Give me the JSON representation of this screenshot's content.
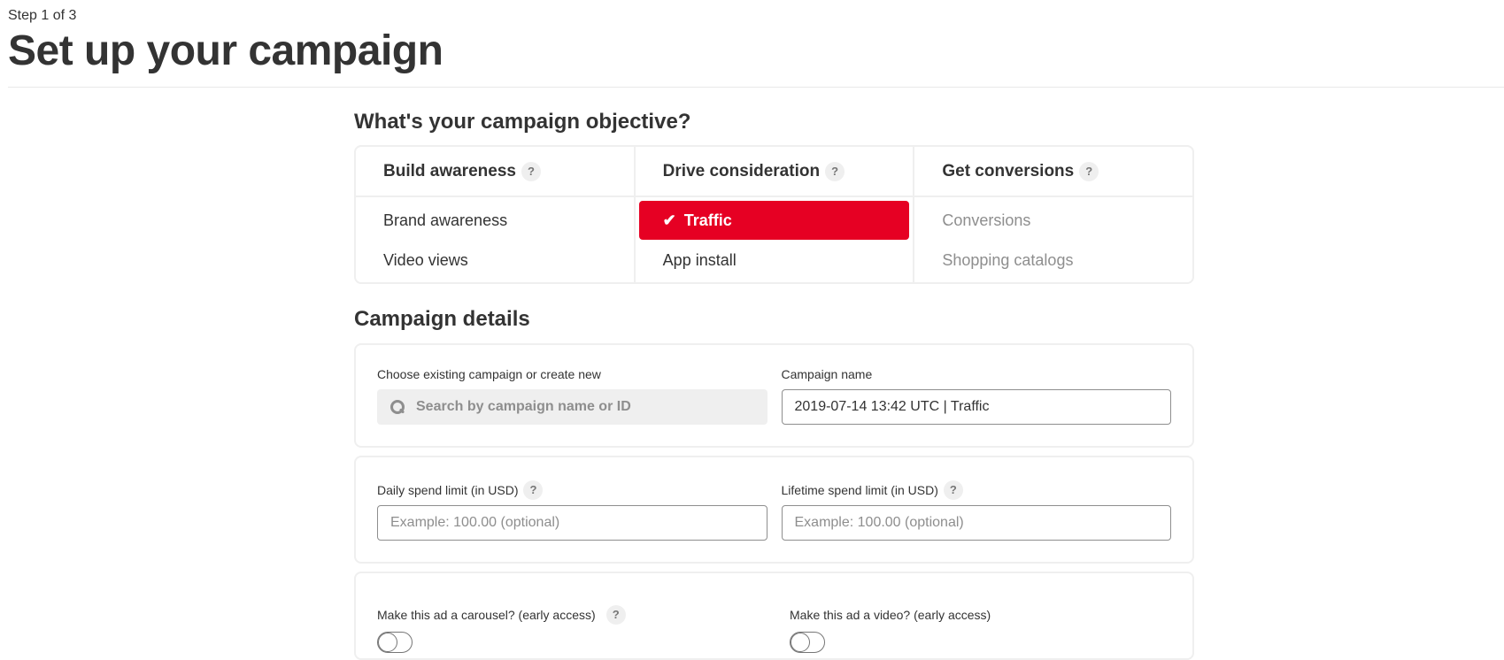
{
  "header": {
    "step": "Step 1 of 3",
    "title": "Set up your campaign"
  },
  "objective": {
    "title": "What's your campaign objective?",
    "columns": [
      {
        "label": "Build awareness",
        "items": [
          {
            "label": "Brand awareness",
            "state": "normal"
          },
          {
            "label": "Video views",
            "state": "normal"
          }
        ]
      },
      {
        "label": "Drive consideration",
        "items": [
          {
            "label": "Traffic",
            "state": "selected"
          },
          {
            "label": "App install",
            "state": "normal"
          }
        ]
      },
      {
        "label": "Get conversions",
        "items": [
          {
            "label": "Conversions",
            "state": "disabled"
          },
          {
            "label": "Shopping catalogs",
            "state": "disabled"
          }
        ]
      }
    ],
    "help_glyph": "?",
    "check_glyph": "✔",
    "accent_color": "#e60023"
  },
  "details": {
    "title": "Campaign details",
    "existing_label": "Choose existing campaign or create new",
    "search_placeholder": "Search by campaign name or ID",
    "name_label": "Campaign name",
    "name_value": "2019-07-14 13:42 UTC | Traffic",
    "daily_label": "Daily spend limit (in USD)",
    "daily_placeholder": "Example: 100.00 (optional)",
    "lifetime_label": "Lifetime spend limit (in USD)",
    "lifetime_placeholder": "Example: 100.00 (optional)",
    "carousel_label": "Make this ad a carousel? (early access)",
    "video_label": "Make this ad a video? (early access)",
    "carousel_on": false,
    "video_on": false
  }
}
